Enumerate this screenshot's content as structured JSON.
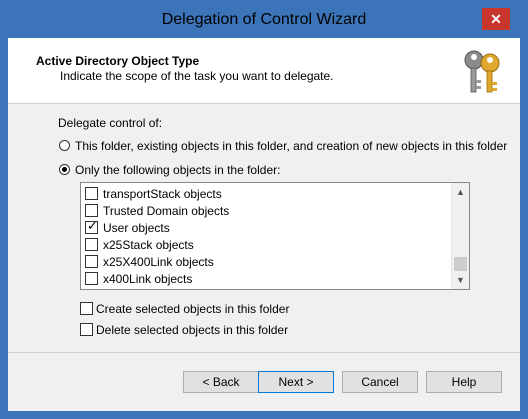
{
  "window": {
    "title": "Delegation of Control Wizard",
    "close_glyph": "✕"
  },
  "header": {
    "title": "Active Directory Object Type",
    "subtitle": "Indicate the scope of the task you want to delegate.",
    "icon": "keys-icon"
  },
  "delegate": {
    "label": "Delegate control of:",
    "options": [
      {
        "label": "This folder, existing objects in this folder, and creation of new objects in this folder",
        "selected": false
      },
      {
        "label": "Only the following objects in the folder:",
        "selected": true
      }
    ]
  },
  "object_list": {
    "items": [
      {
        "label": "transportStack objects",
        "checked": false
      },
      {
        "label": "Trusted Domain objects",
        "checked": false
      },
      {
        "label": "User objects",
        "checked": true
      },
      {
        "label": "x25Stack objects",
        "checked": false
      },
      {
        "label": "x25X400Link objects",
        "checked": false
      },
      {
        "label": "x400Link objects",
        "checked": false
      }
    ]
  },
  "options": {
    "create": {
      "label": "Create selected objects in this folder",
      "checked": false
    },
    "delete": {
      "label": "Delete selected objects in this folder",
      "checked": false
    }
  },
  "buttons": {
    "back": "< Back",
    "next": "Next >",
    "cancel": "Cancel",
    "help": "Help"
  }
}
